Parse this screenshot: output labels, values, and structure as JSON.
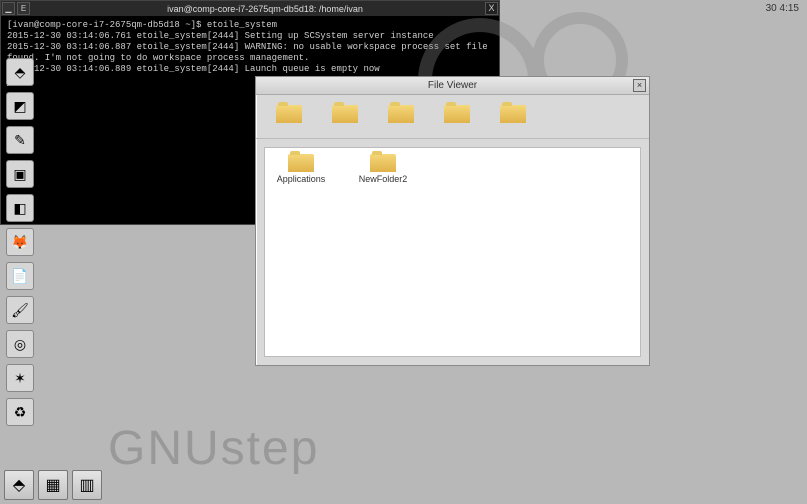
{
  "topbar": {
    "clock": "30 4:15"
  },
  "watermark": "GNUstep",
  "dock": {
    "items": [
      {
        "name": "gnustep-app",
        "glyph": "⬘"
      },
      {
        "name": "workspace-app",
        "glyph": "◩"
      },
      {
        "name": "preferences-app",
        "glyph": "✎"
      },
      {
        "name": "terminal-app",
        "glyph": "▣"
      },
      {
        "name": "imageviewer-app",
        "glyph": "◧"
      },
      {
        "name": "firefox-app",
        "glyph": "🦊"
      },
      {
        "name": "textedit-app",
        "glyph": "📄"
      },
      {
        "name": "gimp-app",
        "glyph": "🖌"
      },
      {
        "name": "media-app",
        "glyph": "◎"
      },
      {
        "name": "etoile-app",
        "glyph": "✶"
      },
      {
        "name": "recycle-app",
        "glyph": "♻"
      }
    ]
  },
  "taskbar": {
    "items": [
      {
        "name": "task-gnustep",
        "glyph": "⬘"
      },
      {
        "name": "task-fileviewer",
        "glyph": "▦"
      },
      {
        "name": "task-terminal",
        "glyph": "▥"
      }
    ]
  },
  "fileviewer": {
    "title": "File Viewer",
    "close": "×",
    "toolbar_items": [
      {
        "name": "path-segment-1"
      },
      {
        "name": "path-segment-2"
      },
      {
        "name": "path-segment-3"
      },
      {
        "name": "path-segment-4"
      },
      {
        "name": "path-segment-5"
      }
    ],
    "body_items": [
      {
        "name": "folder-applications",
        "label": "Applications"
      },
      {
        "name": "folder-newfolder2",
        "label": "NewFolder2"
      }
    ]
  },
  "terminal": {
    "title": "ivan@comp-core-i7-2675qm-db5d18: /home/ivan",
    "minimize": "▁",
    "expand": "E",
    "close": "X",
    "lines": [
      "[ivan@comp-core-i7-2675qm-db5d18 ~]$ etoile_system",
      "2015-12-30 03:14:06.761 etoile_system[2444] Setting up SCSystem server instance",
      "2015-12-30 03:14:06.887 etoile_system[2444] WARNING: no usable workspace process set file found. I'm not going to do workspace process management.",
      "2015-12-30 03:14:06.889 etoile_system[2444] Launch queue is empty now"
    ]
  }
}
